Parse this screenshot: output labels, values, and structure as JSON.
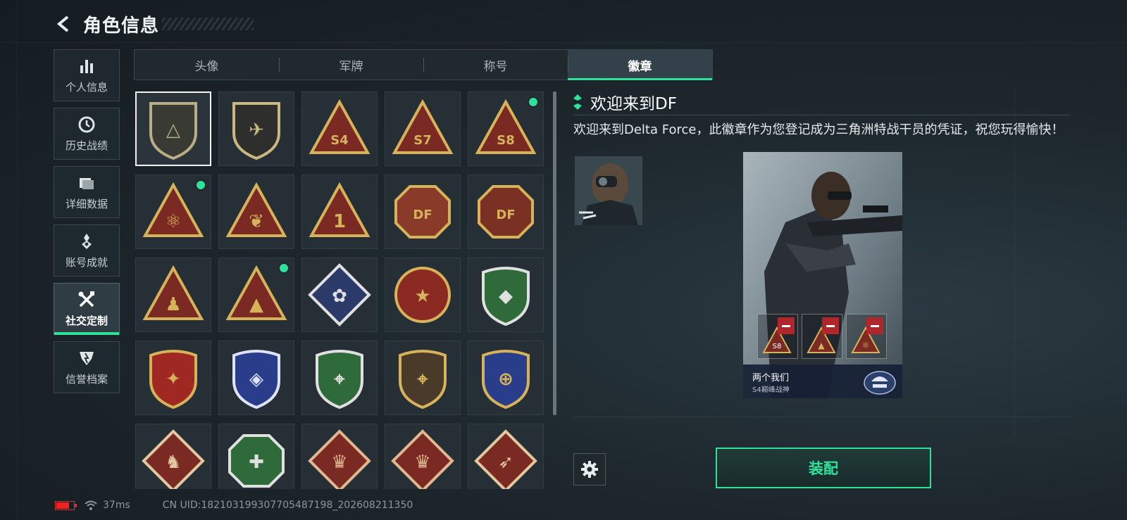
{
  "header": {
    "title": "角色信息"
  },
  "sidebar": {
    "items": [
      {
        "label": "个人信息",
        "icon": "bar-chart-icon",
        "active": false
      },
      {
        "label": "历史战绩",
        "icon": "clock-icon",
        "active": false
      },
      {
        "label": "详细数据",
        "icon": "folder-icon",
        "active": false
      },
      {
        "label": "账号成就",
        "icon": "medal-icon",
        "active": false
      },
      {
        "label": "社交定制",
        "icon": "tools-icon",
        "active": true
      },
      {
        "label": "信誉档案",
        "icon": "shield-icon",
        "active": false
      }
    ]
  },
  "tabs": [
    {
      "label": "头像",
      "active": false
    },
    {
      "label": "军牌",
      "active": false
    },
    {
      "label": "称号",
      "active": false
    },
    {
      "label": "徽章",
      "active": true
    }
  ],
  "badges": [
    {
      "name": "delta-shield",
      "shape": "shield",
      "bg": "#3a3a34",
      "fg": "#b9ad86",
      "glyph": "△",
      "selected": true,
      "new": false
    },
    {
      "name": "helicopter",
      "shape": "shield",
      "bg": "#2e2f2c",
      "fg": "#c8b880",
      "glyph": "✈",
      "selected": false,
      "new": false
    },
    {
      "name": "s4",
      "shape": "triangle",
      "bg": "#7a2a22",
      "fg": "#d6b25a",
      "glyph": "S4",
      "selected": false,
      "new": false
    },
    {
      "name": "s7",
      "shape": "triangle",
      "bg": "#7a2a22",
      "fg": "#d6b25a",
      "glyph": "S7",
      "selected": false,
      "new": false
    },
    {
      "name": "s8",
      "shape": "triangle",
      "bg": "#7a2a22",
      "fg": "#d6b25a",
      "glyph": "S8",
      "selected": false,
      "new": true
    },
    {
      "name": "atom",
      "shape": "triangle",
      "bg": "#7a2a22",
      "fg": "#d6b25a",
      "glyph": "⚛",
      "selected": false,
      "new": true
    },
    {
      "name": "wings",
      "shape": "triangle",
      "bg": "#7a2a22",
      "fg": "#d6b25a",
      "glyph": "❦",
      "selected": false,
      "new": false
    },
    {
      "name": "number-one",
      "shape": "triangle",
      "bg": "#7a2a22",
      "fg": "#d6b25a",
      "glyph": "1",
      "selected": false,
      "new": false
    },
    {
      "name": "delta-force-tank",
      "shape": "octagon",
      "bg": "#8a3a28",
      "fg": "#d6b25a",
      "glyph": "DF",
      "selected": false,
      "new": false
    },
    {
      "name": "delta-force-2026",
      "shape": "octagon",
      "bg": "#7a3022",
      "fg": "#d6b25a",
      "glyph": "DF",
      "selected": false,
      "new": false
    },
    {
      "name": "soldiers",
      "shape": "triangle",
      "bg": "#7a2a22",
      "fg": "#d6b25a",
      "glyph": "♟",
      "selected": false,
      "new": false
    },
    {
      "name": "rocket",
      "shape": "triangle",
      "bg": "#7a2a22",
      "fg": "#d6b25a",
      "glyph": "▲",
      "selected": false,
      "new": true
    },
    {
      "name": "rose",
      "shape": "diamond",
      "bg": "#2c3a6a",
      "fg": "#e0e0e0",
      "glyph": "✿",
      "selected": false,
      "new": false
    },
    {
      "name": "star-circle",
      "shape": "circle",
      "bg": "#8a2a22",
      "fg": "#d6b25a",
      "glyph": "★",
      "selected": false,
      "new": false
    },
    {
      "name": "green-crest",
      "shape": "crest",
      "bg": "#2e6a3a",
      "fg": "#e0e0e0",
      "glyph": "◆",
      "selected": false,
      "new": false
    },
    {
      "name": "red-crest",
      "shape": "crest",
      "bg": "#a02822",
      "fg": "#d6b25a",
      "glyph": "✦",
      "selected": false,
      "new": false
    },
    {
      "name": "blue-gem",
      "shape": "crest",
      "bg": "#2a3d8a",
      "fg": "#dfe3ff",
      "glyph": "◈",
      "selected": false,
      "new": false
    },
    {
      "name": "green-rifle",
      "shape": "crest",
      "bg": "#2e6a3a",
      "fg": "#e0e0e0",
      "glyph": "⌖",
      "selected": false,
      "new": false
    },
    {
      "name": "brown-rifle",
      "shape": "crest",
      "bg": "#4a3a2a",
      "fg": "#d6b25a",
      "glyph": "⌖",
      "selected": false,
      "new": false
    },
    {
      "name": "blue-target",
      "shape": "crest",
      "bg": "#2a3d8a",
      "fg": "#d6b25a",
      "glyph": "⊕",
      "selected": false,
      "new": false
    },
    {
      "name": "wolf",
      "shape": "diamond",
      "bg": "#7a2a22",
      "fg": "#e0c8a0",
      "glyph": "♞",
      "selected": false,
      "new": false
    },
    {
      "name": "medic",
      "shape": "octagon",
      "bg": "#2e6a3a",
      "fg": "#e0e0e0",
      "glyph": "✚",
      "selected": false,
      "new": false
    },
    {
      "name": "dragon-a",
      "shape": "diamond",
      "bg": "#7a2a22",
      "fg": "#e0b890",
      "glyph": "♛",
      "selected": false,
      "new": false
    },
    {
      "name": "dragon-b",
      "shape": "diamond",
      "bg": "#7a2a22",
      "fg": "#e0b890",
      "glyph": "♛",
      "selected": false,
      "new": false
    },
    {
      "name": "runner",
      "shape": "diamond",
      "bg": "#7a2a22",
      "fg": "#e0c8a0",
      "glyph": "➶",
      "selected": false,
      "new": false
    }
  ],
  "detail": {
    "title": "欢迎来到DF",
    "description": "欢迎来到Delta Force，此徽章作为您登记成为三角洲特战干员的凭证，祝您玩得愉快！",
    "card": {
      "name": "两个我们",
      "subtitle": "S4巅峰战神",
      "slot_badges": [
        "S8",
        "▲",
        "⚛"
      ]
    },
    "equip_label": "装配"
  },
  "status": {
    "ping": "37ms",
    "uid": "CN UID:182103199307705487198_202608211350"
  },
  "colors": {
    "accent": "#2fe29a",
    "danger": "#b0272b"
  }
}
